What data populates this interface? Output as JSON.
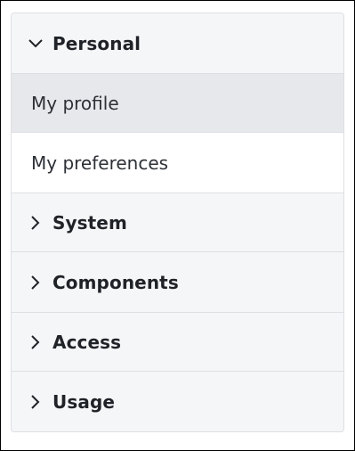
{
  "nav": {
    "personal": {
      "label": "Personal",
      "expanded": true,
      "items": [
        {
          "label": "My profile",
          "active": true
        },
        {
          "label": "My preferences",
          "active": false
        }
      ]
    },
    "system": {
      "label": "System",
      "expanded": false
    },
    "components": {
      "label": "Components",
      "expanded": false
    },
    "access": {
      "label": "Access",
      "expanded": false
    },
    "usage": {
      "label": "Usage",
      "expanded": false
    }
  },
  "colors": {
    "panel_bg": "#f5f6f7",
    "active_bg": "#e6e8eb",
    "border": "#dcdfe3",
    "text": "#1f2328"
  }
}
